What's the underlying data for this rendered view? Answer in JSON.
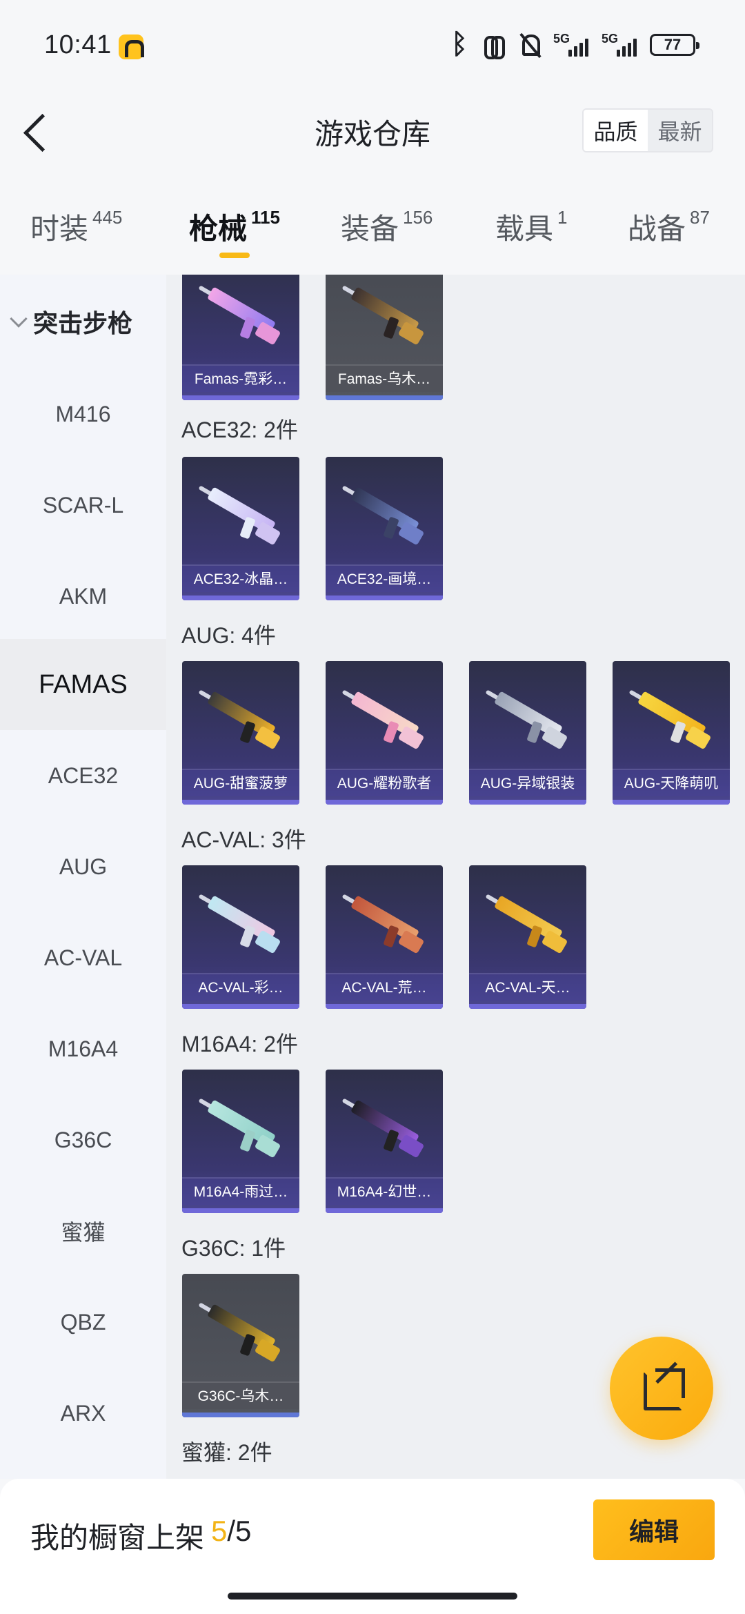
{
  "status_bar": {
    "time": "10:41",
    "battery": "77",
    "network": [
      "5G",
      "5G"
    ],
    "icons": [
      "bluetooth-icon",
      "earbuds-icon",
      "mute-icon",
      "signal-icon",
      "battery-icon"
    ]
  },
  "header": {
    "title": "游戏仓库",
    "sort_options": [
      "品质",
      "最新"
    ],
    "sort_active": "品质"
  },
  "tabs": [
    {
      "label": "时装",
      "count": "445"
    },
    {
      "label": "枪械",
      "count": "115",
      "active": true
    },
    {
      "label": "装备",
      "count": "156"
    },
    {
      "label": "载具",
      "count": "1"
    },
    {
      "label": "战备",
      "count": "87"
    }
  ],
  "sidebar": {
    "category": "突击步枪",
    "items": [
      "M416",
      "SCAR-L",
      "AKM",
      "FAMAS",
      "ACE32",
      "AUG",
      "AC-VAL",
      "M16A4",
      "G36C",
      "蜜獾",
      "QBZ",
      "ARX"
    ],
    "active": "FAMAS"
  },
  "groups": [
    {
      "title": "",
      "items": [
        {
          "name": "Famas-霓彩…",
          "gray": false
        },
        {
          "name": "Famas-乌木…",
          "gray": true
        }
      ]
    },
    {
      "title": "ACE32: 2件",
      "items": [
        {
          "name": "ACE32-冰晶…",
          "gray": false
        },
        {
          "name": "ACE32-画境…",
          "gray": false
        }
      ]
    },
    {
      "title": "AUG: 4件",
      "items": [
        {
          "name": "AUG-甜蜜菠萝",
          "gray": false
        },
        {
          "name": "AUG-耀粉歌者",
          "gray": false
        },
        {
          "name": "AUG-异域银装",
          "gray": false
        },
        {
          "name": "AUG-天降萌叽",
          "gray": false
        }
      ]
    },
    {
      "title": "AC-VAL: 3件",
      "items": [
        {
          "name": "AC-VAL-彩…",
          "gray": false
        },
        {
          "name": "AC-VAL-荒…",
          "gray": false
        },
        {
          "name": "AC-VAL-天…",
          "gray": false
        }
      ]
    },
    {
      "title": "M16A4: 2件",
      "items": [
        {
          "name": "M16A4-雨过…",
          "gray": false
        },
        {
          "name": "M16A4-幻世…",
          "gray": false
        }
      ]
    },
    {
      "title": "G36C: 1件",
      "items": [
        {
          "name": "G36C-乌木…",
          "gray": true
        }
      ]
    },
    {
      "title": "蜜獾: 2件",
      "items": []
    }
  ],
  "bottom_bar": {
    "label": "我的橱窗上架",
    "count_current": "5",
    "count_total": "/5",
    "edit_label": "编辑"
  },
  "colors": {
    "accent": "#f8b916",
    "card_bg": "#3a3770",
    "card_bar": "#6f68d8"
  }
}
